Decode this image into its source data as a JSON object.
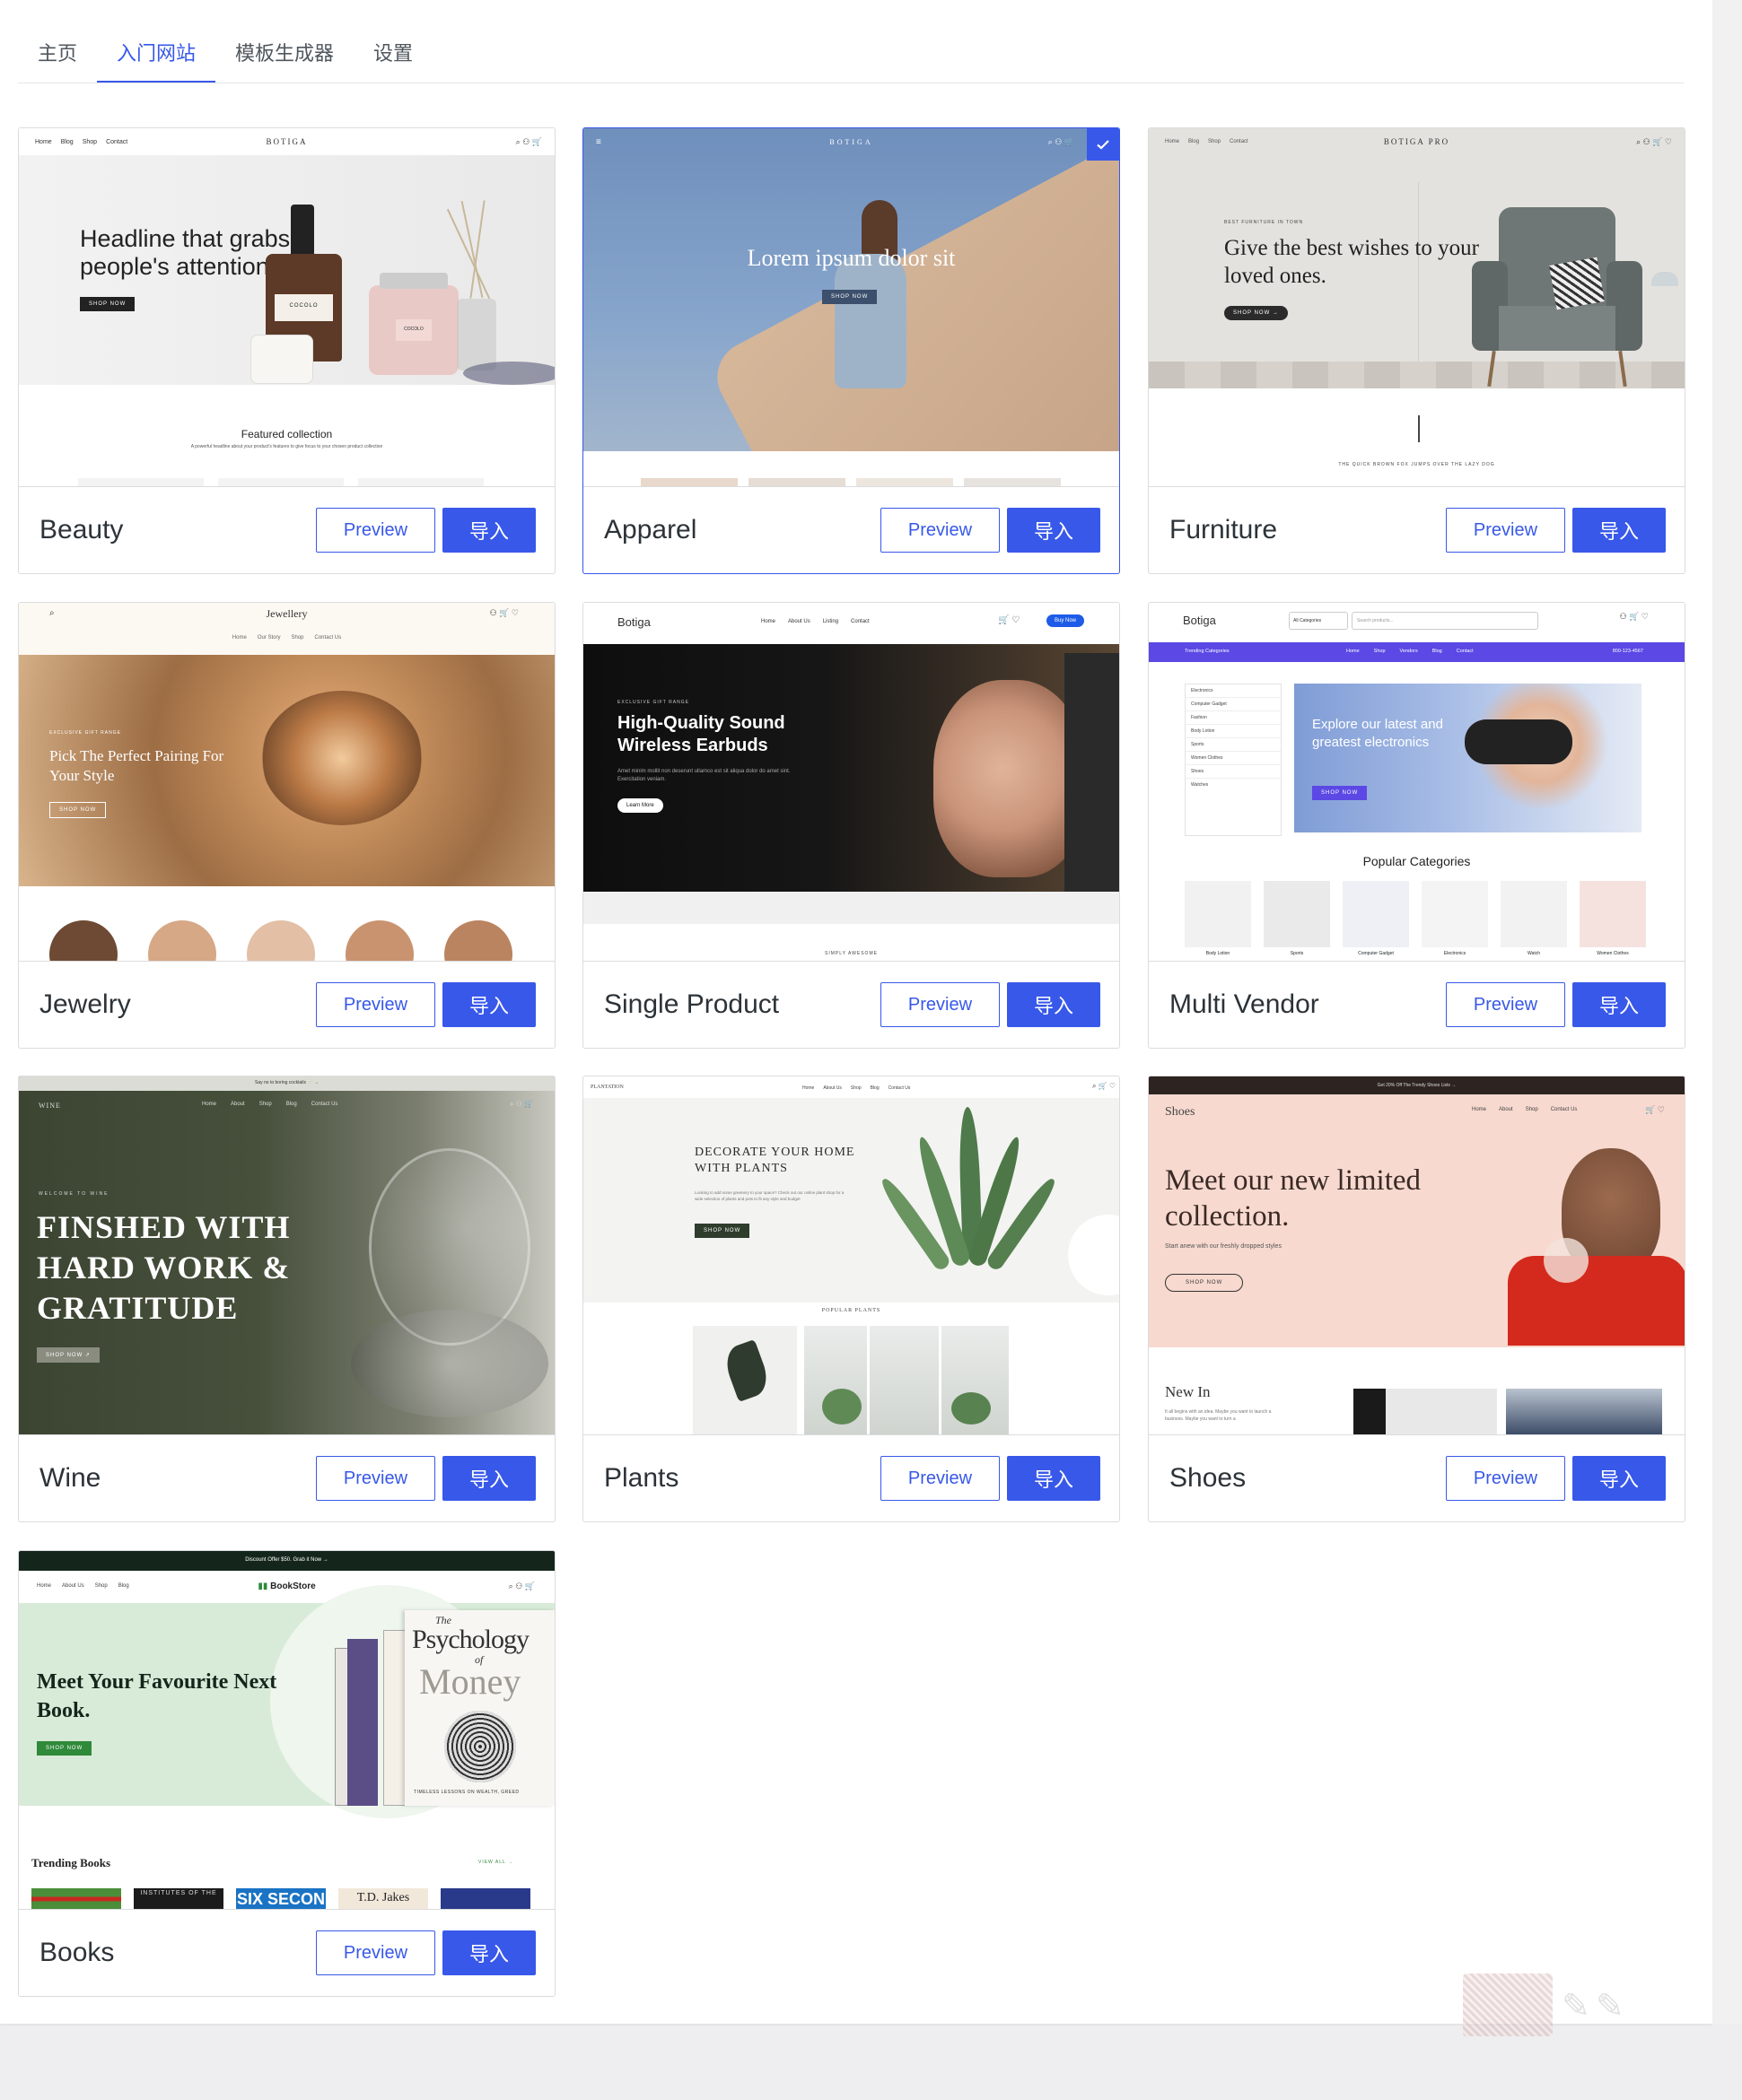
{
  "tabs": [
    {
      "label": "主页",
      "active": false
    },
    {
      "label": "入门网站",
      "active": true
    },
    {
      "label": "模板生成器",
      "active": false
    },
    {
      "label": "设置",
      "active": false
    }
  ],
  "buttons": {
    "preview": "Preview",
    "import": "导入"
  },
  "accent_color": "#3858e9",
  "cards": [
    {
      "title": "Beauty",
      "selected": false,
      "thumb": {
        "nav_links": [
          "Home",
          "Blog",
          "Shop",
          "Contact"
        ],
        "logo": "BOTIGA",
        "headline": "Headline that grabs people's attention",
        "cta": "SHOP NOW",
        "section_title": "Featured collection",
        "section_sub": "A powerful headline about your product's features to give focus to your chosen product collection",
        "product_label_1": "COCOLO",
        "product_label_2": "COCOLO"
      }
    },
    {
      "title": "Apparel",
      "selected": true,
      "thumb": {
        "logo": "BOTIGA",
        "headline": "Lorem ipsum dolor sit",
        "cta": "SHOP NOW"
      }
    },
    {
      "title": "Furniture",
      "selected": false,
      "thumb": {
        "nav_links": [
          "Home",
          "Blog",
          "Shop",
          "Contact"
        ],
        "logo": "BOTIGA PRO",
        "eyebrow": "BEST FURNITURE IN TOWN",
        "headline": "Give the best wishes to your loved ones.",
        "cta": "SHOP NOW →",
        "footnote": "THE QUICK BROWN FOX JUMPS OVER THE LAZY DOG"
      }
    },
    {
      "title": "Jewelry",
      "selected": false,
      "thumb": {
        "logo": "Jewellery",
        "nav_links": [
          "Home",
          "Our Story",
          "Shop",
          "Contact Us"
        ],
        "eyebrow": "EXCLUSIVE GIFT RANGE",
        "headline": "Pick The Perfect Pairing For Your Style",
        "cta": "SHOP NOW"
      }
    },
    {
      "title": "Single Product",
      "selected": false,
      "thumb": {
        "logo": "Botiga",
        "nav_links": [
          "Home",
          "About Us",
          "Listing",
          "Contact"
        ],
        "nav_cta": "Buy Now",
        "eyebrow": "EXCLUSIVE GIFT RANGE",
        "headline": "High-Quality Sound Wireless Earbuds",
        "body": "Amet minim mollit non deserunt ullamco est sit aliqua dolor do amet sint. Exercitation veniam.",
        "cta": "Learn More",
        "footnote": "SIMPLY AWESOME"
      }
    },
    {
      "title": "Multi Vendor",
      "selected": false,
      "thumb": {
        "logo": "Botiga",
        "category_select": "All Categories",
        "search_placeholder": "Search products...",
        "trending": "Trending Categories",
        "nav_links": [
          "Home",
          "Shop",
          "Vendors",
          "Blog",
          "Contact"
        ],
        "phone": "800-123-4567",
        "side_categories": [
          "Electronics",
          "Computer Gadget",
          "Fashion",
          "Body Lotion",
          "Sports",
          "Women Clothes",
          "Shoes",
          "Watches"
        ],
        "headline": "Explore our latest and greatest electronics",
        "cta": "SHOP NOW",
        "section_title": "Popular Categories",
        "categories": [
          "Body Lotion",
          "Sports",
          "Computer Gadget",
          "Electronics",
          "Watch",
          "Women Clothes"
        ]
      }
    },
    {
      "title": "Wine",
      "selected": false,
      "thumb": {
        "topbar": "Say no to boring cocktails 🍸 →",
        "logo": "WINE",
        "nav_links": [
          "Home",
          "About",
          "Shop",
          "Blog",
          "Contact Us"
        ],
        "eyebrow": "WELCOME TO WINE",
        "headline": "FINSHED WITH HARD WORK & GRATITUDE",
        "cta": "SHOP NOW ↗"
      }
    },
    {
      "title": "Plants",
      "selected": false,
      "thumb": {
        "logo": "PLANTATION",
        "nav_links": [
          "Home",
          "About Us",
          "Shop",
          "Blog",
          "Contact Us"
        ],
        "headline": "DECORATE YOUR HOME WITH PLANTS",
        "body": "Looking to add some greenery to your space? Check out our online plant shop for a wide selection of plants and pots to fit any style and budget",
        "cta": "SHOP NOW",
        "section_title": "POPULAR PLANTS"
      }
    },
    {
      "title": "Shoes",
      "selected": false,
      "thumb": {
        "topbar": "Get 20% Off The Trendy Shoes Lists →",
        "logo": "Shoes",
        "nav_links": [
          "Home",
          "About",
          "Shop",
          "Contact Us"
        ],
        "headline": "Meet our new limited collection.",
        "sub": "Start anew with our freshly dropped styles",
        "cta": "SHOP NOW",
        "section_title": "New In",
        "section_body": "It all begins with an idea. Maybe you want to launch a business. Maybe you want to turn a"
      }
    },
    {
      "title": "Books",
      "selected": false,
      "thumb": {
        "topbar": "Discount Offer $50. Grab it Now →",
        "nav_links": [
          "Home",
          "About Us",
          "Shop",
          "Blog"
        ],
        "logo": "BookStore",
        "headline": "Meet Your Favourite Next Book.",
        "cta": "SHOP NOW",
        "book_title_1": "The",
        "book_title_2": "Psychology",
        "book_title_3": "of",
        "book_title_4": "Money",
        "book_tagline": "TIMELESS LESSONS ON WEALTH, GREED",
        "section_title": "Trending Books",
        "view_all": "VIEW ALL →",
        "shelf": [
          "INSTITUTES OF THE",
          "SIX SECON",
          "T.D. Jakes"
        ]
      }
    }
  ]
}
